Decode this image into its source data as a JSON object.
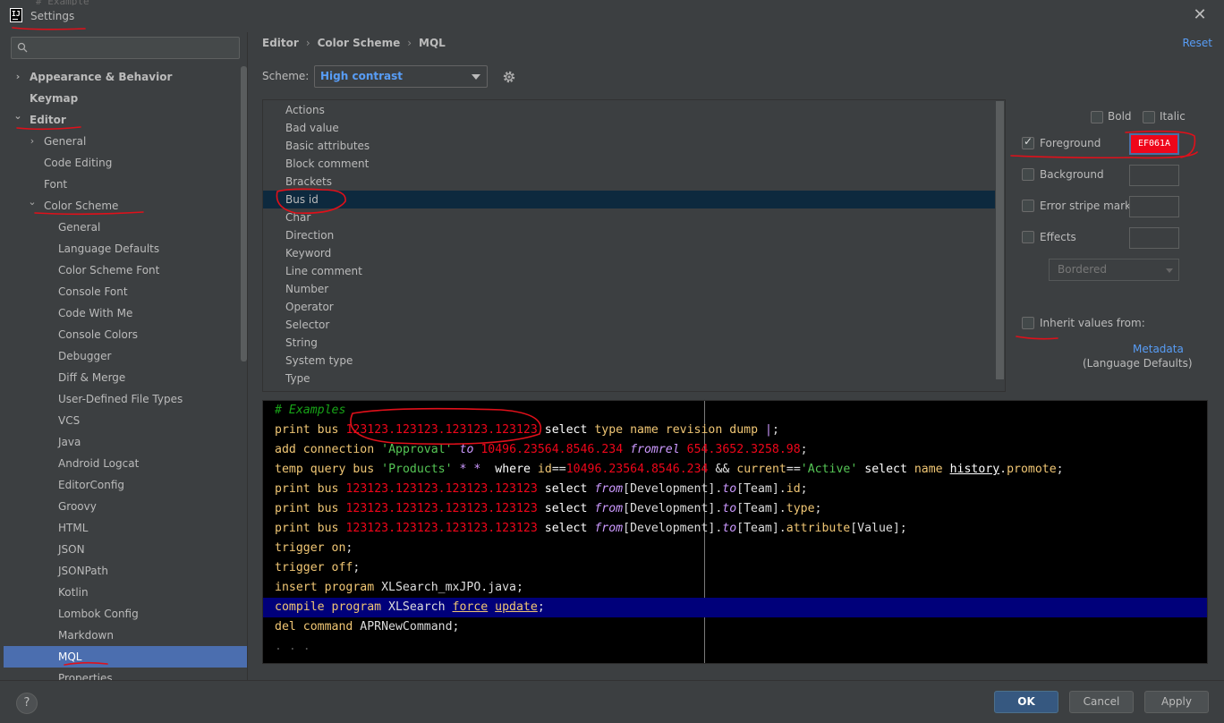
{
  "window": {
    "title": "Settings",
    "behind_text": "# Example"
  },
  "breadcrumb": [
    "Editor",
    "Color Scheme",
    "MQL"
  ],
  "reset_label": "Reset",
  "scheme": {
    "label": "Scheme:",
    "value": "High contrast"
  },
  "sidebar": {
    "search_placeholder": "",
    "items": [
      {
        "label": "Appearance & Behavior",
        "level": 0,
        "arrow": "right",
        "bold": true
      },
      {
        "label": "Keymap",
        "level": 0,
        "arrow": "",
        "bold": true
      },
      {
        "label": "Editor",
        "level": 0,
        "arrow": "down",
        "bold": true
      },
      {
        "label": "General",
        "level": 1,
        "arrow": "right"
      },
      {
        "label": "Code Editing",
        "level": 1,
        "arrow": ""
      },
      {
        "label": "Font",
        "level": 1,
        "arrow": ""
      },
      {
        "label": "Color Scheme",
        "level": 1,
        "arrow": "down"
      },
      {
        "label": "General",
        "level": 2,
        "arrow": ""
      },
      {
        "label": "Language Defaults",
        "level": 2,
        "arrow": ""
      },
      {
        "label": "Color Scheme Font",
        "level": 2,
        "arrow": ""
      },
      {
        "label": "Console Font",
        "level": 2,
        "arrow": ""
      },
      {
        "label": "Code With Me",
        "level": 2,
        "arrow": ""
      },
      {
        "label": "Console Colors",
        "level": 2,
        "arrow": ""
      },
      {
        "label": "Debugger",
        "level": 2,
        "arrow": ""
      },
      {
        "label": "Diff & Merge",
        "level": 2,
        "arrow": ""
      },
      {
        "label": "User-Defined File Types",
        "level": 2,
        "arrow": ""
      },
      {
        "label": "VCS",
        "level": 2,
        "arrow": ""
      },
      {
        "label": "Java",
        "level": 2,
        "arrow": ""
      },
      {
        "label": "Android Logcat",
        "level": 2,
        "arrow": ""
      },
      {
        "label": "EditorConfig",
        "level": 2,
        "arrow": ""
      },
      {
        "label": "Groovy",
        "level": 2,
        "arrow": ""
      },
      {
        "label": "HTML",
        "level": 2,
        "arrow": ""
      },
      {
        "label": "JSON",
        "level": 2,
        "arrow": ""
      },
      {
        "label": "JSONPath",
        "level": 2,
        "arrow": ""
      },
      {
        "label": "Kotlin",
        "level": 2,
        "arrow": ""
      },
      {
        "label": "Lombok Config",
        "level": 2,
        "arrow": ""
      },
      {
        "label": "Markdown",
        "level": 2,
        "arrow": ""
      },
      {
        "label": "MQL",
        "level": 2,
        "arrow": "",
        "selected": true
      },
      {
        "label": "Properties",
        "level": 2,
        "arrow": ""
      }
    ]
  },
  "elements": {
    "items": [
      "Actions",
      "Bad value",
      "Basic attributes",
      "Block comment",
      "Brackets",
      "Bus id",
      "Char",
      "Direction",
      "Keyword",
      "Line comment",
      "Number",
      "Operator",
      "Selector",
      "String",
      "System type",
      "Type"
    ],
    "selected": "Bus id"
  },
  "options": {
    "bold": {
      "label": "Bold",
      "checked": false
    },
    "italic": {
      "label": "Italic",
      "checked": false
    },
    "foreground": {
      "label": "Foreground",
      "checked": true,
      "value": "EF061A",
      "color": "#ef061a"
    },
    "background": {
      "label": "Background",
      "checked": false
    },
    "error_stripe": {
      "label": "Error stripe mark",
      "checked": false
    },
    "effects": {
      "label": "Effects",
      "checked": false,
      "style": "Bordered"
    },
    "inherit": {
      "label": "Inherit values from:",
      "checked": false,
      "link": "Metadata",
      "sub": "(Language Defaults)"
    }
  },
  "preview": {
    "lines": [
      [
        [
          "t-cm",
          "# Examples"
        ]
      ],
      [
        [
          "t-kw",
          "print"
        ],
        [
          "",
          " "
        ],
        [
          "t-kw",
          "bus"
        ],
        [
          "",
          " "
        ],
        [
          "t-red",
          "123123.123123.123123.123123"
        ],
        [
          "",
          " "
        ],
        [
          "t-w",
          "select"
        ],
        [
          "",
          " "
        ],
        [
          "t-kw",
          "type"
        ],
        [
          "",
          " "
        ],
        [
          "t-kw",
          "name"
        ],
        [
          "",
          " "
        ],
        [
          "t-kw",
          "revision"
        ],
        [
          "",
          " "
        ],
        [
          "t-kw",
          "dump"
        ],
        [
          "",
          " "
        ],
        [
          "t-it",
          "|"
        ],
        [
          "",
          ";"
        ]
      ],
      [
        [
          "t-kw",
          "add"
        ],
        [
          "",
          " "
        ],
        [
          "t-kw",
          "connection"
        ],
        [
          "",
          " "
        ],
        [
          "t-str",
          "'Approval'"
        ],
        [
          "",
          " "
        ],
        [
          "t-it",
          "to"
        ],
        [
          "",
          " "
        ],
        [
          "t-red",
          "10496.23564.8546.234"
        ],
        [
          "",
          " "
        ],
        [
          "t-it",
          "fromrel"
        ],
        [
          "",
          " "
        ],
        [
          "t-red",
          "654.3652.3258.98"
        ],
        [
          "",
          ";"
        ]
      ],
      [
        [
          "t-kw",
          "temp"
        ],
        [
          "",
          " "
        ],
        [
          "t-kw",
          "query"
        ],
        [
          "",
          " "
        ],
        [
          "t-kw",
          "bus"
        ],
        [
          "",
          " "
        ],
        [
          "t-str",
          "'Products'"
        ],
        [
          "",
          " "
        ],
        [
          "t-it",
          "*"
        ],
        [
          "",
          " "
        ],
        [
          "t-it",
          "*"
        ],
        [
          "",
          "  "
        ],
        [
          "t-w",
          "where"
        ],
        [
          "",
          " "
        ],
        [
          "t-kw",
          "id"
        ],
        [
          "t-op",
          "=="
        ],
        [
          "t-red",
          "10496.23564.8546.234"
        ],
        [
          "",
          " "
        ],
        [
          "t-op",
          "&&"
        ],
        [
          "",
          " "
        ],
        [
          "t-kw",
          "current"
        ],
        [
          "t-op",
          "=="
        ],
        [
          "t-str",
          "'Active'"
        ],
        [
          "",
          " "
        ],
        [
          "t-w",
          "select"
        ],
        [
          "",
          " "
        ],
        [
          "t-kw",
          "name"
        ],
        [
          "",
          " "
        ],
        [
          "t-w t-ul",
          "history"
        ],
        [
          "",
          "."
        ],
        [
          "t-kw",
          "promote"
        ],
        [
          "",
          ";"
        ]
      ],
      [
        [
          "t-kw",
          "print"
        ],
        [
          "",
          " "
        ],
        [
          "t-kw",
          "bus"
        ],
        [
          "",
          " "
        ],
        [
          "t-red",
          "123123.123123.123123.123123"
        ],
        [
          "",
          " "
        ],
        [
          "t-w",
          "select"
        ],
        [
          "",
          " "
        ],
        [
          "t-it",
          "from"
        ],
        [
          "",
          "[Development]."
        ],
        [
          "t-it",
          "to"
        ],
        [
          "",
          "[Team]."
        ],
        [
          "t-kw",
          "id"
        ],
        [
          "",
          ";"
        ]
      ],
      [
        [
          "t-kw",
          "print"
        ],
        [
          "",
          " "
        ],
        [
          "t-kw",
          "bus"
        ],
        [
          "",
          " "
        ],
        [
          "t-red",
          "123123.123123.123123.123123"
        ],
        [
          "",
          " "
        ],
        [
          "t-w",
          "select"
        ],
        [
          "",
          " "
        ],
        [
          "t-it",
          "from"
        ],
        [
          "",
          "[Development]."
        ],
        [
          "t-it",
          "to"
        ],
        [
          "",
          "[Team]."
        ],
        [
          "t-kw",
          "type"
        ],
        [
          "",
          ";"
        ]
      ],
      [
        [
          "t-kw",
          "print"
        ],
        [
          "",
          " "
        ],
        [
          "t-kw",
          "bus"
        ],
        [
          "",
          " "
        ],
        [
          "t-red",
          "123123.123123.123123.123123"
        ],
        [
          "",
          " "
        ],
        [
          "t-w",
          "select"
        ],
        [
          "",
          " "
        ],
        [
          "t-it",
          "from"
        ],
        [
          "",
          "[Development]."
        ],
        [
          "t-it",
          "to"
        ],
        [
          "",
          "[Team]."
        ],
        [
          "t-kw",
          "attribute"
        ],
        [
          "",
          "[Value];"
        ]
      ],
      [
        [
          "t-kw",
          "trigger"
        ],
        [
          "",
          " "
        ],
        [
          "t-kw",
          "on"
        ],
        [
          "",
          ";"
        ]
      ],
      [
        [
          "t-kw",
          "trigger"
        ],
        [
          "",
          " "
        ],
        [
          "t-kw",
          "off"
        ],
        [
          "",
          ";"
        ]
      ],
      [
        [
          "t-kw",
          "insert"
        ],
        [
          "",
          " "
        ],
        [
          "t-kw",
          "program"
        ],
        [
          "",
          " XLSearch_mxJPO.java;"
        ]
      ],
      [
        [
          "t-kw",
          "compile"
        ],
        [
          "",
          " "
        ],
        [
          "t-kw",
          "program"
        ],
        [
          "",
          " XLSearch "
        ],
        [
          "t-kw t-ul",
          "force"
        ],
        [
          "",
          " "
        ],
        [
          "t-kw t-ul",
          "update"
        ],
        [
          "",
          ";"
        ]
      ],
      [
        [
          "t-kw",
          "del"
        ],
        [
          "",
          " "
        ],
        [
          "t-kw",
          "command"
        ],
        [
          "",
          " APRNewCommand;"
        ]
      ],
      [
        [
          "t-dim",
          ". . ."
        ]
      ]
    ],
    "highlight_line": 10
  },
  "buttons": {
    "help": "?",
    "ok": "OK",
    "cancel": "Cancel",
    "apply": "Apply"
  }
}
